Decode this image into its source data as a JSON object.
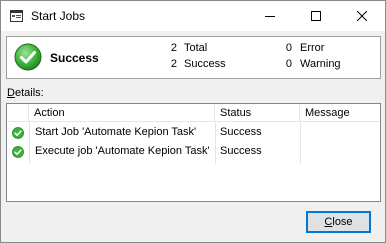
{
  "window": {
    "title": "Start Jobs",
    "icon": "window-icon"
  },
  "summary": {
    "status": "Success",
    "total_count": "2",
    "total_label": "Total",
    "success_count": "2",
    "success_label": "Success",
    "error_count": "0",
    "error_label": "Error",
    "warning_count": "0",
    "warning_label": "Warning"
  },
  "details": {
    "label_accel": "D",
    "label_rest": "etails:",
    "columns": [
      "Action",
      "Status",
      "Message"
    ],
    "rows": [
      {
        "action": "Start Job 'Automate Kepion Task'",
        "status": "Success",
        "message": ""
      },
      {
        "action": "Execute job 'Automate Kepion Task'",
        "status": "Success",
        "message": ""
      }
    ]
  },
  "buttons": {
    "close_accel": "C",
    "close_rest": "lose"
  },
  "colors": {
    "success_green": "#3bb33b",
    "accent": "#0078d7"
  }
}
